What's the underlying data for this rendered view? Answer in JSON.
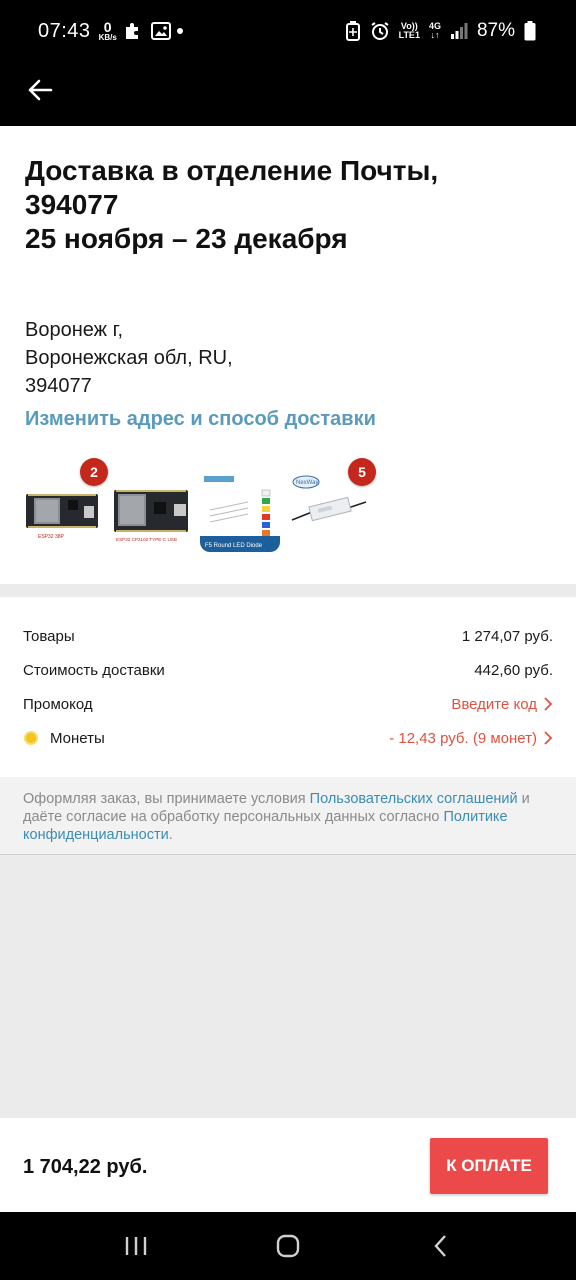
{
  "status_bar": {
    "time": "07:43",
    "net_speed_value": "0",
    "net_speed_unit": "KB/s",
    "lte_top": "Vo))",
    "lte_bottom": "LTE1",
    "signal_type": "4G",
    "battery": "87%"
  },
  "app_bar": {
    "back_icon": "arrow-left-icon"
  },
  "delivery": {
    "title_line1": "Доставка в отделение Почты,",
    "title_line2": "394077",
    "title_line3": "25 ноября – 23 декабря",
    "address_line1": "Воронеж г,",
    "address_line2": "Воронежская обл, RU,",
    "address_line3": "394077",
    "change_link": "Изменить адрес и способ доставки",
    "products": [
      {
        "caption": "ESP32 38P",
        "badge": "2"
      },
      {
        "caption": "ESP32 CP2102 TYPE-C USB",
        "badge": ""
      },
      {
        "caption": "F5 Round LED Diode",
        "badge": ""
      },
      {
        "caption": "NexWay",
        "badge": "5"
      }
    ]
  },
  "summary": {
    "goods_label": "Товары",
    "goods_value": "1 274,07 руб.",
    "shipping_label": "Стоимость доставки",
    "shipping_value": "442,60 руб.",
    "promo_label": "Промокод",
    "promo_value": "Введите код",
    "coins_label": "Монеты",
    "coins_value": "- 12,43 руб. (9 монет)"
  },
  "legal": {
    "text1": "Оформляя заказ, вы принимаете условия ",
    "link1": "Пользовательских соглашений",
    "text2": " и даёте согласие на обработку персональных данных согласно ",
    "link2": "Политике конфиденциальности",
    "text3": "."
  },
  "checkout": {
    "total": "1 704,22 руб.",
    "pay_button": "К ОПЛАТЕ"
  },
  "colors": {
    "accent_red": "#ec4a4a",
    "link_blue": "#3a8db5",
    "badge_red": "#c4281c"
  }
}
